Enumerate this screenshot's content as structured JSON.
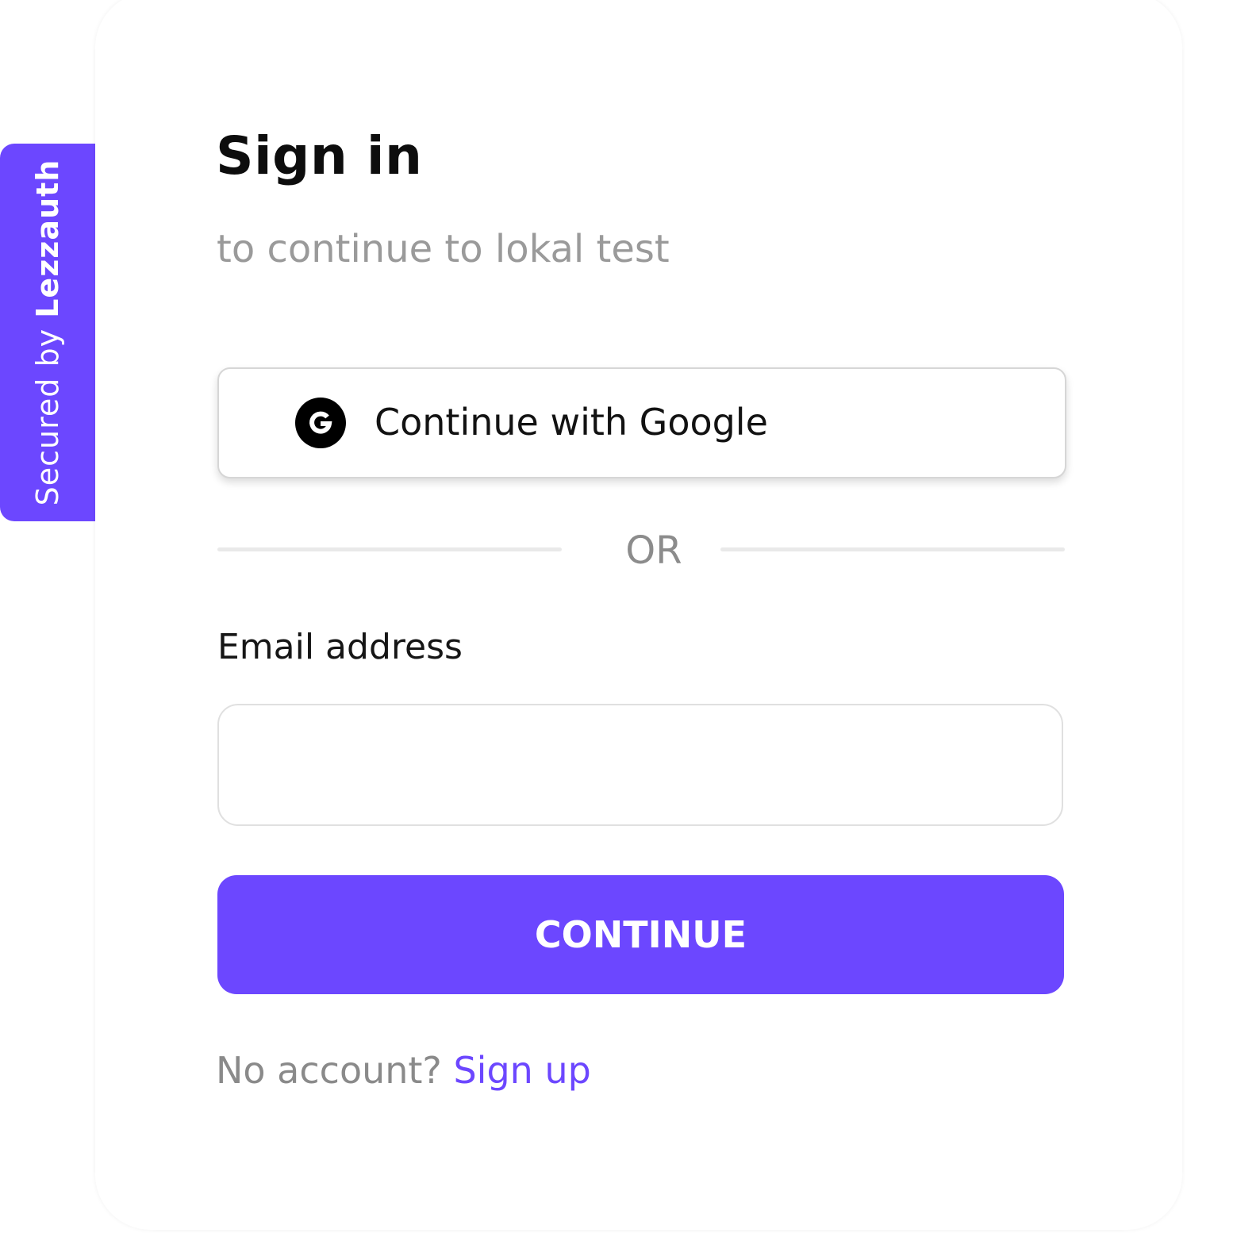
{
  "badge": {
    "prefix": "Secured by",
    "brand": "Lezzauth"
  },
  "signin": {
    "title": "Sign in",
    "subtitle": "to continue to lokal test"
  },
  "google": {
    "label": "Continue with Google",
    "icon": "google-icon"
  },
  "divider": {
    "label": "OR"
  },
  "email": {
    "label": "Email address",
    "value": "",
    "placeholder": ""
  },
  "continue_button": {
    "label": "CONTINUE"
  },
  "footer": {
    "prompt": "No account?",
    "link": "Sign up"
  },
  "colors": {
    "accent": "#6c47ff",
    "subtitle": "#9a9a9a",
    "divider": "#e9e9e9"
  }
}
